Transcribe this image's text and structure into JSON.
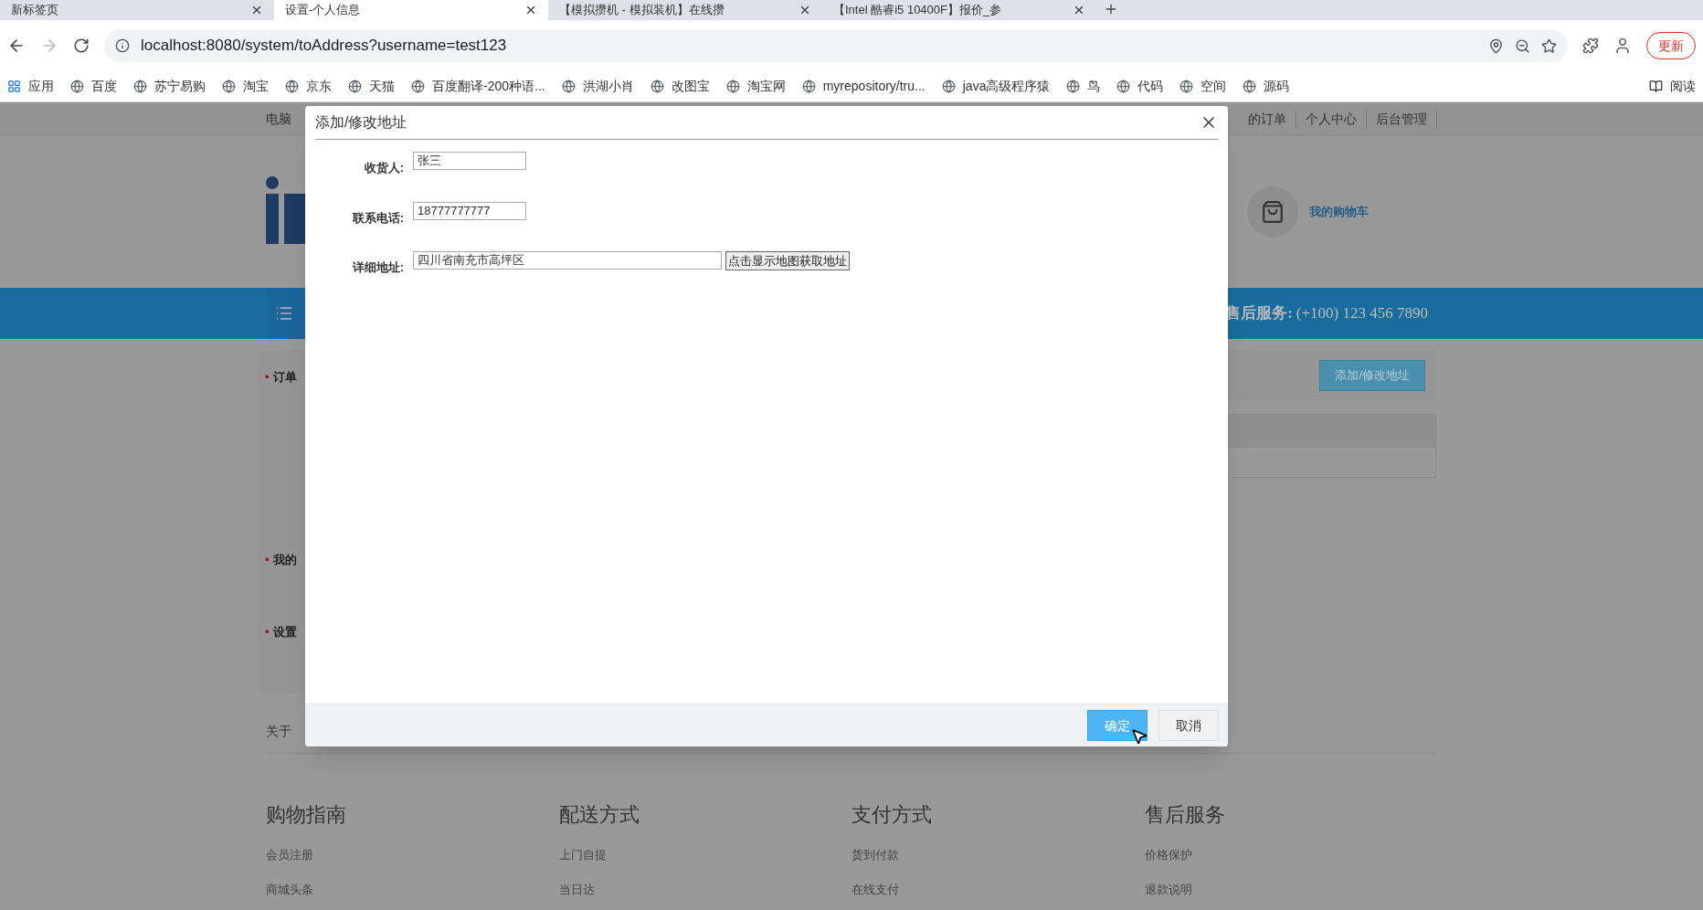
{
  "browser": {
    "tabs": [
      {
        "title": "新标签页",
        "selected": false
      },
      {
        "title": "设置-个人信息",
        "selected": true
      },
      {
        "title": "【模拟攒机 - 模拟装机】在线攒",
        "selected": false
      },
      {
        "title": "【Intel 酷睿i5 10400F】报价_参",
        "selected": false
      }
    ],
    "address": "localhost:8080/system/toAddress?username=test123",
    "update_button": "更新",
    "bookmarks": [
      {
        "label": "应用",
        "kind": "apps"
      },
      {
        "label": "百度",
        "kind": "site"
      },
      {
        "label": "苏宁易购",
        "kind": "site"
      },
      {
        "label": "淘宝",
        "kind": "site"
      },
      {
        "label": "京东",
        "kind": "site"
      },
      {
        "label": "天猫",
        "kind": "site"
      },
      {
        "label": "百度翻译-200种语...",
        "kind": "site"
      },
      {
        "label": "洪湖小肖",
        "kind": "site"
      },
      {
        "label": "改图宝",
        "kind": "site"
      },
      {
        "label": "淘宝网",
        "kind": "site"
      },
      {
        "label": "myrepository/tru...",
        "kind": "site"
      },
      {
        "label": "java高级程序猿",
        "kind": "site"
      },
      {
        "label": "鸟",
        "kind": "site"
      },
      {
        "label": "代码",
        "kind": "site"
      },
      {
        "label": "空间",
        "kind": "site"
      },
      {
        "label": "源码",
        "kind": "site"
      }
    ],
    "reading_list": "阅读"
  },
  "page": {
    "top_left": "电脑",
    "top_right": [
      "的订单",
      "个人中心",
      "后台管理"
    ],
    "cart_label": "我的购物车",
    "service_label": "售后服务:",
    "service_phone": "(+100) 123 456 7890",
    "sidebar": [
      {
        "bullet": "•",
        "label": "订单"
      },
      {
        "bullet": "•",
        "label": "我的"
      },
      {
        "bullet": "•",
        "label": "设置"
      }
    ],
    "address_button": "添加/修改地址",
    "about": "关于",
    "footer_columns": [
      {
        "heading": "购物指南",
        "links": [
          "会员注册",
          "商城头条"
        ]
      },
      {
        "heading": "配送方式",
        "links": [
          "上门自提",
          "当日达"
        ]
      },
      {
        "heading": "支付方式",
        "links": [
          "货到付款",
          "在线支付"
        ]
      },
      {
        "heading": "售后服务",
        "links": [
          "价格保护",
          "退款说明"
        ]
      }
    ]
  },
  "dialog": {
    "title": "添加/修改地址",
    "fields": [
      {
        "label": "收货人:",
        "value": "张三"
      },
      {
        "label": "联系电话:",
        "value": "18777777777"
      },
      {
        "label": "详细地址:",
        "value": "四川省南充市高坪区"
      }
    ],
    "map_button": "点击显示地图获取地址",
    "buttons": [
      {
        "label": "确定",
        "kind": "primary"
      },
      {
        "label": "取消",
        "kind": "secondary"
      }
    ]
  }
}
